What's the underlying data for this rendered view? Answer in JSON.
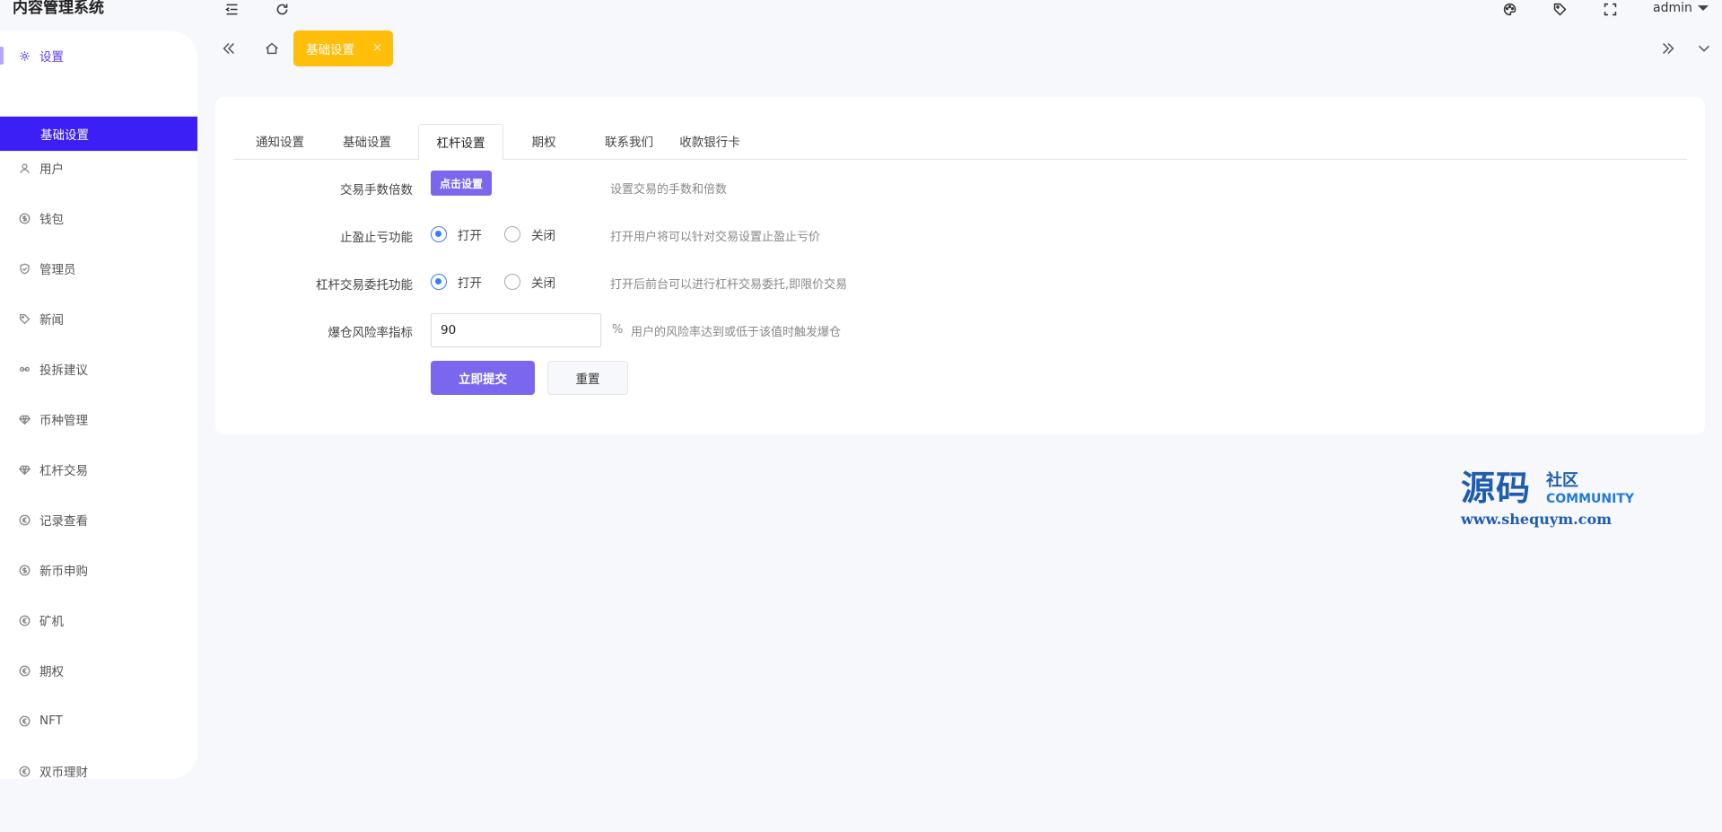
{
  "app": {
    "title": "内容管理系统"
  },
  "header": {
    "user": "admin"
  },
  "sidebar": {
    "items": [
      {
        "label": "设置",
        "icon": "gear-icon"
      },
      {
        "label": "用户",
        "icon": "user-icon"
      },
      {
        "label": "钱包",
        "icon": "dollar-icon"
      },
      {
        "label": "管理员",
        "icon": "shield-icon"
      },
      {
        "label": "新闻",
        "icon": "tag-icon"
      },
      {
        "label": "投拆建议",
        "icon": "link-icon"
      },
      {
        "label": "币种管理",
        "icon": "diamond-icon"
      },
      {
        "label": "杠杆交易",
        "icon": "diamond-icon"
      },
      {
        "label": "记录查看",
        "icon": "euro-icon"
      },
      {
        "label": "新币申购",
        "icon": "dollar-icon"
      },
      {
        "label": "矿机",
        "icon": "euro-icon"
      },
      {
        "label": "期权",
        "icon": "euro-icon"
      },
      {
        "label": "NFT",
        "icon": "euro-icon"
      },
      {
        "label": "双币理财",
        "icon": "euro-icon"
      }
    ],
    "sub_item": "基础设置"
  },
  "page_tab": {
    "label": "基础设置",
    "close": "×"
  },
  "tabs": [
    "通知设置",
    "基础设置",
    "杠杆设置",
    "期权",
    "联系我们",
    "收款银行卡"
  ],
  "active_tab": "杠杆设置",
  "form": {
    "fee": {
      "label": "交易手数倍数",
      "button": "点击设置",
      "hint": "设置交易的手数和倍数"
    },
    "stop": {
      "label": "止盈止亏功能",
      "on": "打开",
      "off": "关闭",
      "hint": "打开用户将可以针对交易设置止盈止亏价",
      "value": "on"
    },
    "entrust": {
      "label": "杠杆交易委托功能",
      "on": "打开",
      "off": "关闭",
      "hint": "打开后前台可以进行杠杆交易委托,即限价交易",
      "value": "on"
    },
    "risk": {
      "label": "爆仓风险率指标",
      "value": "90",
      "unit": "%",
      "hint": "用户的风险率达到或低于该值时触发爆仓"
    },
    "submit": "立即提交",
    "reset": "重置"
  },
  "watermark": {
    "main": "源码",
    "sub": "社区",
    "community": "COMMUNITY",
    "url": "www.shequym.com"
  },
  "colors": {
    "accent": "#7a67ee",
    "active_menu": "#3b1ff5",
    "page_tab": "#ffbe0a",
    "radio": "#3d7bf7"
  }
}
